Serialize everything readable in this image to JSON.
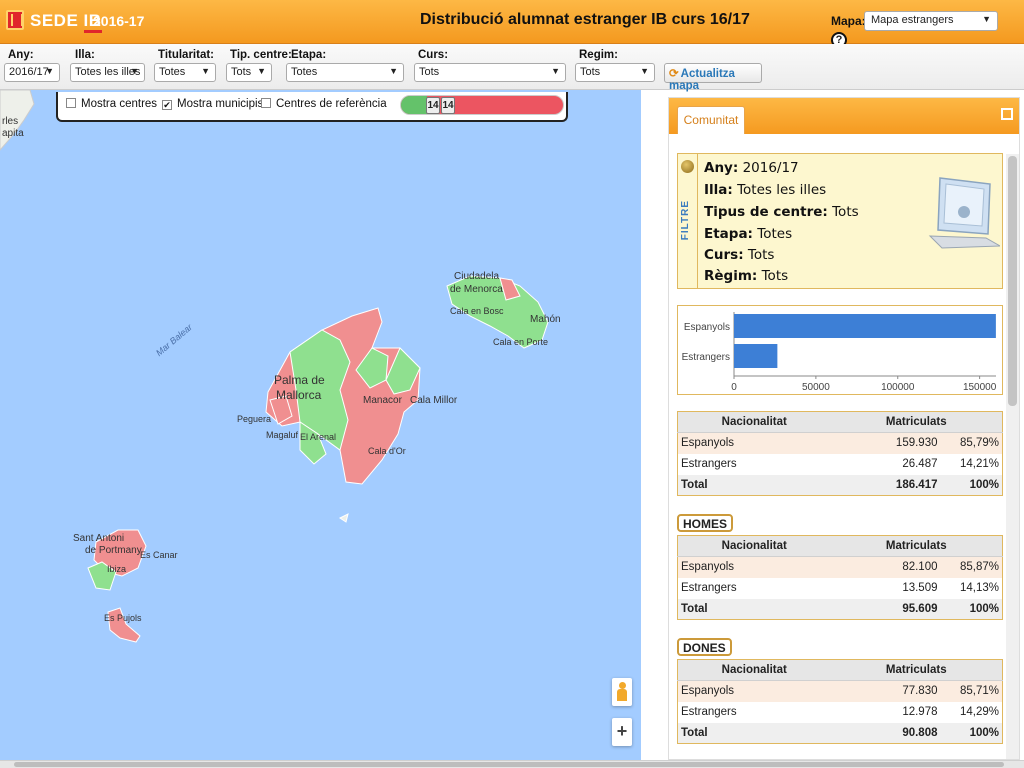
{
  "header": {
    "brand_prefix": "SEDE",
    "brand_suffix": "IB",
    "year": "2016-17",
    "title": "Distribució alumnat estranger IB curs 16/17",
    "mapa_label": "Mapa:",
    "mapa_value": "Mapa estrangers",
    "help": "?"
  },
  "filters": [
    {
      "label": "Any:",
      "value": "2016/17"
    },
    {
      "label": "Illa:",
      "value": "Totes les illes"
    },
    {
      "label": "Titularitat:",
      "value": "Totes"
    },
    {
      "label": "Tip. centre:",
      "value": "Tots"
    },
    {
      "label": "Etapa:",
      "value": "Totes"
    },
    {
      "label": "Curs:",
      "value": "Tots"
    },
    {
      "label": "Regim:",
      "value": "Tots"
    }
  ],
  "update_button": "Actualitza mapa",
  "map_controls": {
    "mostra_centres": {
      "label": "Mostra centres",
      "checked": false
    },
    "mostra_municipis": {
      "label": "Mostra municipis",
      "checked": true
    },
    "centres_referencia": {
      "label": "Centres de referència",
      "checked": false
    },
    "slider_low": "14",
    "slider_high": "14",
    "check_mark": "✔"
  },
  "map": {
    "sea_label": "Mar Balear",
    "corner_label_1": "rles",
    "corner_label_2": "apita",
    "labels": [
      "Ciudadela",
      "de Menorca",
      "Cala en Bosc",
      "Mahón",
      "Cala en Porte",
      "Palma de",
      "Mallorca",
      "Manacor",
      "Cala Millor",
      "Peguera",
      "Magaluf",
      "El Arenal",
      "Cala d'Or",
      "Sant Antoni",
      "de Portmany",
      "Es Canar",
      "Ibiza",
      "Es Pujols"
    ],
    "colors": {
      "sea": "#a3ccff",
      "red": "#f08f90",
      "green": "#8fe08f"
    },
    "zoom_in": "+"
  },
  "panel": {
    "tab": "Comunitat",
    "filter_tag": "FILTRE",
    "filter_rows": [
      {
        "k": "Any:",
        "v": "2016/17"
      },
      {
        "k": "Illa:",
        "v": "Totes les illes"
      },
      {
        "k": "Tipus de centre:",
        "v": "Tots"
      },
      {
        "k": "Etapa:",
        "v": "Totes"
      },
      {
        "k": "Curs:",
        "v": "Tots"
      },
      {
        "k": "Règim:",
        "v": "Tots"
      }
    ],
    "sections": [
      {
        "title": "",
        "headers": [
          "Nacionalitat",
          "Matriculats",
          ""
        ],
        "rows": [
          [
            "Espanyols",
            "159.930",
            "85,79%"
          ],
          [
            "Estrangers",
            "26.487",
            "14,21%"
          ]
        ],
        "total": [
          "Total",
          "186.417",
          "100%"
        ]
      },
      {
        "title": "HOMES",
        "headers": [
          "Nacionalitat",
          "Matriculats",
          ""
        ],
        "rows": [
          [
            "Espanyols",
            "82.100",
            "85,87%"
          ],
          [
            "Estrangers",
            "13.509",
            "14,13%"
          ]
        ],
        "total": [
          "Total",
          "95.609",
          "100%"
        ]
      },
      {
        "title": "DONES",
        "headers": [
          "Nacionalitat",
          "Matriculats",
          ""
        ],
        "rows": [
          [
            "Espanyols",
            "77.830",
            "85,71%"
          ],
          [
            "Estrangers",
            "12.978",
            "14,29%"
          ]
        ],
        "total": [
          "Total",
          "90.808",
          "100%"
        ]
      }
    ]
  },
  "chart_data": {
    "type": "bar",
    "orientation": "horizontal",
    "categories": [
      "Espanyols",
      "Estrangers"
    ],
    "values": [
      159930,
      26487
    ],
    "xlim": [
      0,
      160000
    ],
    "xticks": [
      "0",
      "50000",
      "100000",
      "150000"
    ],
    "xtick_values": [
      0,
      50000,
      100000,
      150000
    ],
    "color": "#3d7fd6",
    "grid": false
  }
}
